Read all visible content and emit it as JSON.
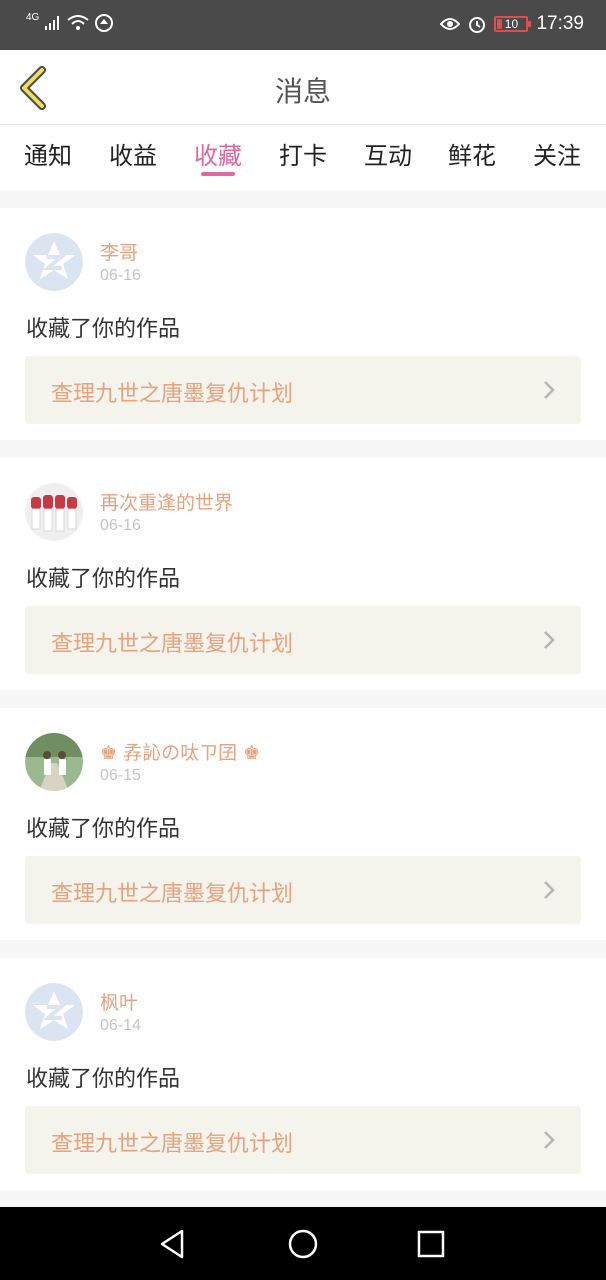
{
  "status_bar": {
    "network": "4G",
    "battery": "10",
    "time": "17:39"
  },
  "header": {
    "title": "消息"
  },
  "tabs": [
    {
      "label": "通知"
    },
    {
      "label": "收益"
    },
    {
      "label": "收藏",
      "active": true
    },
    {
      "label": "打卡"
    },
    {
      "label": "互动"
    },
    {
      "label": "鲜花"
    },
    {
      "label": "关注"
    }
  ],
  "items": [
    {
      "user": "李哥",
      "date": "06-16",
      "action": "收藏了你的作品",
      "work": "查理九世之唐墨复仇计划",
      "avatar": "default-avatar-icon"
    },
    {
      "user": "再次重逢的世界",
      "date": "06-16",
      "action": "收藏了你的作品",
      "work": "查理九世之唐墨复仇计划",
      "avatar": "photo-avatar"
    },
    {
      "user": "♚ 孨訫の呔ㄗ囝 ♚",
      "date": "06-15",
      "action": "收藏了你的作品",
      "work": "查理九世之唐墨复仇计划",
      "avatar": "photo-avatar"
    },
    {
      "user": "枫叶",
      "date": "06-14",
      "action": "收藏了你的作品",
      "work": "查理九世之唐墨复仇计划",
      "avatar": "default-avatar-icon"
    }
  ],
  "colors": {
    "accent": "#e0679f",
    "username": "#e8a27d",
    "status_bar": "#4a4a4a",
    "link_bg": "#f4f3ec"
  }
}
